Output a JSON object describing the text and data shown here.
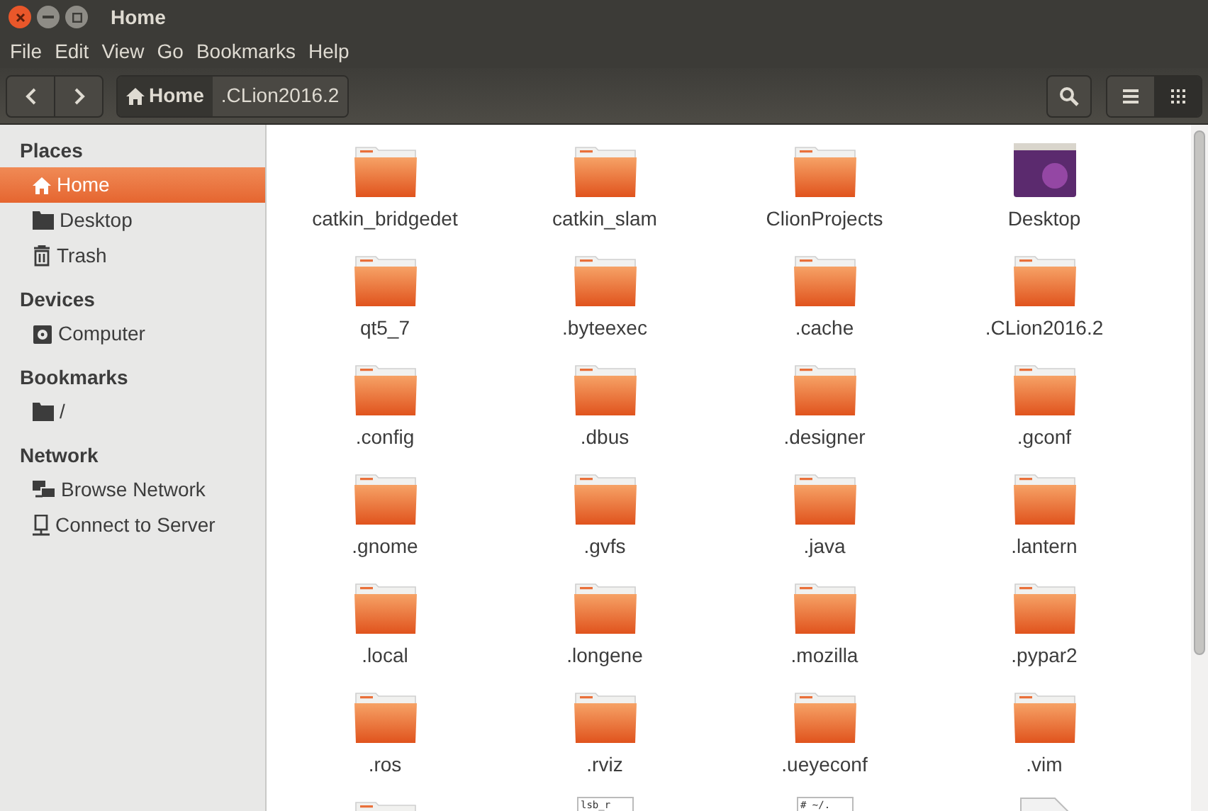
{
  "window": {
    "title": "Home"
  },
  "menu": [
    "File",
    "Edit",
    "View",
    "Go",
    "Bookmarks",
    "Help"
  ],
  "path": [
    {
      "label": "Home",
      "selected": true,
      "kind": "home"
    },
    {
      "label": ".CLion2016.2",
      "selected": false,
      "kind": "plain"
    }
  ],
  "view_buttons": [
    {
      "kind": "list",
      "selected": false
    },
    {
      "kind": "grid",
      "selected": true
    }
  ],
  "sidebar": [
    {
      "heading": "Places",
      "items": [
        {
          "label": "Home",
          "kind": "home",
          "selected": true
        },
        {
          "label": "Desktop",
          "kind": "folder",
          "selected": false
        },
        {
          "label": "Trash",
          "kind": "trash",
          "selected": false
        }
      ]
    },
    {
      "heading": "Devices",
      "items": [
        {
          "label": "Computer",
          "kind": "drive",
          "selected": false
        }
      ]
    },
    {
      "heading": "Bookmarks",
      "items": [
        {
          "label": "/",
          "kind": "folder",
          "selected": false
        }
      ]
    },
    {
      "heading": "Network",
      "items": [
        {
          "label": "Browse Network",
          "kind": "network",
          "selected": false
        },
        {
          "label": "Connect to Server",
          "kind": "server",
          "selected": false
        }
      ]
    }
  ],
  "files": [
    {
      "name": "catkin_bridgedet",
      "kind": "folder"
    },
    {
      "name": "catkin_slam",
      "kind": "folder"
    },
    {
      "name": "ClionProjects",
      "kind": "folder"
    },
    {
      "name": "Desktop",
      "kind": "desktop"
    },
    {
      "name": "qt5_7",
      "kind": "folder"
    },
    {
      "name": ".byteexec",
      "kind": "folder"
    },
    {
      "name": ".cache",
      "kind": "folder"
    },
    {
      "name": ".CLion2016.2",
      "kind": "folder"
    },
    {
      "name": ".config",
      "kind": "folder"
    },
    {
      "name": ".dbus",
      "kind": "folder"
    },
    {
      "name": ".designer",
      "kind": "folder"
    },
    {
      "name": ".gconf",
      "kind": "folder"
    },
    {
      "name": ".gnome",
      "kind": "folder"
    },
    {
      "name": ".gvfs",
      "kind": "folder"
    },
    {
      "name": ".java",
      "kind": "folder"
    },
    {
      "name": ".lantern",
      "kind": "folder"
    },
    {
      "name": ".local",
      "kind": "folder"
    },
    {
      "name": ".longene",
      "kind": "folder"
    },
    {
      "name": ".mozilla",
      "kind": "folder"
    },
    {
      "name": ".pypar2",
      "kind": "folder"
    },
    {
      "name": ".ros",
      "kind": "folder"
    },
    {
      "name": ".rviz",
      "kind": "folder"
    },
    {
      "name": ".ueyeconf",
      "kind": "folder"
    },
    {
      "name": ".vim",
      "kind": "folder"
    },
    {
      "kind": "folder"
    },
    {
      "kind": "text",
      "preview": "lsb_r"
    },
    {
      "kind": "text",
      "preview": "# ~/."
    },
    {
      "kind": "file"
    }
  ]
}
